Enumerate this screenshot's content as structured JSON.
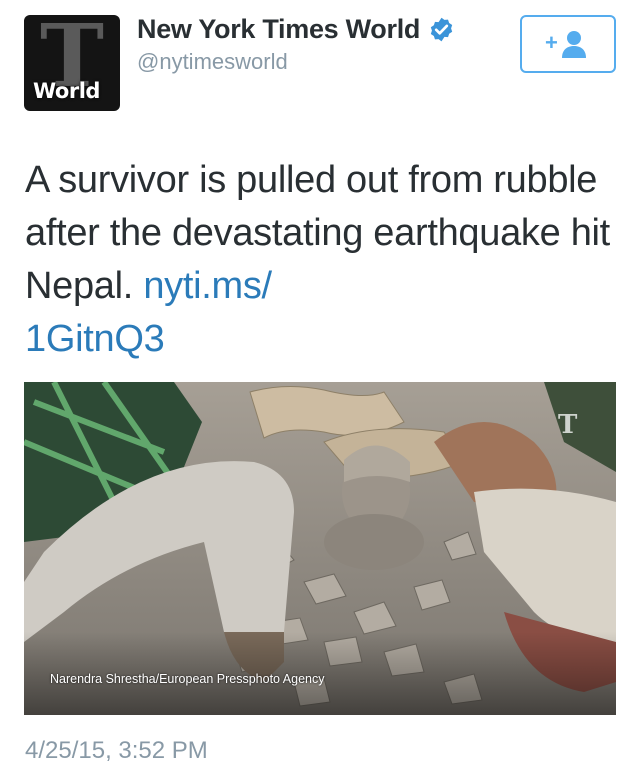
{
  "account": {
    "display_name": "New York Times World",
    "handle": "@nytimesworld",
    "avatar_logo": "T",
    "avatar_label": "World",
    "verified": true
  },
  "follow_button": {
    "icon": "follow-user-icon",
    "symbol": "+"
  },
  "tweet": {
    "text": "A survivor is pulled out from rubble after the devastating earthquake hit Nepal. ",
    "link_text": "nyti.ms/\n1GitnQ3"
  },
  "media": {
    "credit": "Narendra Shrestha/European Pressphoto Agency",
    "watermark": "T"
  },
  "timestamp": "4/25/15, 3:52 PM",
  "colors": {
    "link": "#2b7bb9",
    "accent": "#55acee",
    "muted": "#8899a6",
    "text": "#292f33",
    "verified": "#3b94d9"
  }
}
